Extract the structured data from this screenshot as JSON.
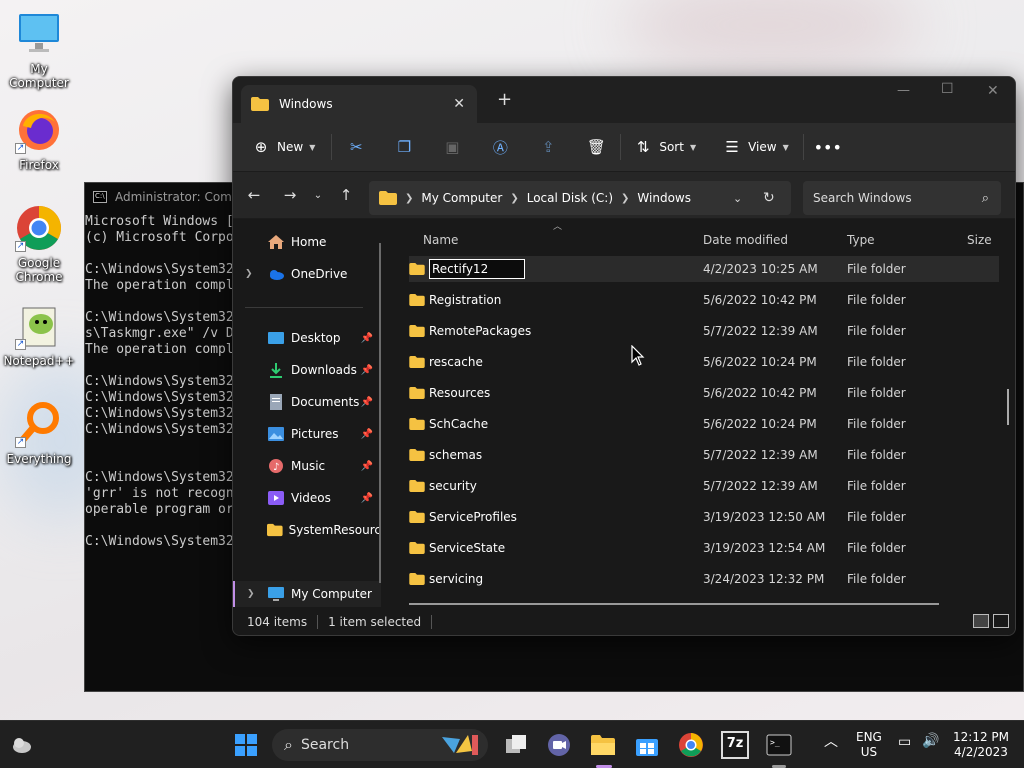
{
  "desktop": {
    "icons": [
      {
        "label": "My Computer"
      },
      {
        "label": "Firefox"
      },
      {
        "label": "Google Chrome"
      },
      {
        "label": "Notepad++"
      },
      {
        "label": "Everything"
      }
    ]
  },
  "cmd": {
    "title": "Administrator: Comm",
    "lines": "Microsoft Windows [\n(c) Microsoft Corpo\n\nC:\\Windows\\System32\nThe operation compl\n\nC:\\Windows\\System32\ns\\Taskmgr.exe\" /v D\nThe operation compl\n\nC:\\Windows\\System32\nC:\\Windows\\System32\nC:\\Windows\\System32\nC:\\Windows\\System32\n\n\nC:\\Windows\\System32\n'grr' is not recogn\noperable program or\n\nC:\\Windows\\System32"
  },
  "explorer": {
    "tab_title": "Windows",
    "toolbar": {
      "new_label": "New",
      "sort_label": "Sort",
      "view_label": "View"
    },
    "breadcrumb": [
      "My Computer",
      "Local Disk (C:)",
      "Windows"
    ],
    "search_placeholder": "Search Windows",
    "nav": {
      "home": "Home",
      "onedrive": "OneDrive",
      "desktop": "Desktop",
      "downloads": "Downloads",
      "documents": "Documents",
      "pictures": "Pictures",
      "music": "Music",
      "videos": "Videos",
      "systemresources": "SystemResourc",
      "mycomputer": "My Computer"
    },
    "columns": {
      "name": "Name",
      "date": "Date modified",
      "type": "Type",
      "size": "Size"
    },
    "rows": [
      {
        "name": "Rectify12",
        "date": "4/2/2023 10:25 AM",
        "type": "File folder"
      },
      {
        "name": "Registration",
        "date": "5/6/2022 10:42 PM",
        "type": "File folder"
      },
      {
        "name": "RemotePackages",
        "date": "5/7/2022 12:39 AM",
        "type": "File folder"
      },
      {
        "name": "rescache",
        "date": "5/6/2022 10:24 PM",
        "type": "File folder"
      },
      {
        "name": "Resources",
        "date": "5/6/2022 10:42 PM",
        "type": "File folder"
      },
      {
        "name": "SchCache",
        "date": "5/6/2022 10:24 PM",
        "type": "File folder"
      },
      {
        "name": "schemas",
        "date": "5/7/2022 12:39 AM",
        "type": "File folder"
      },
      {
        "name": "security",
        "date": "5/7/2022 12:39 AM",
        "type": "File folder"
      },
      {
        "name": "ServiceProfiles",
        "date": "3/19/2023 12:50 AM",
        "type": "File folder"
      },
      {
        "name": "ServiceState",
        "date": "3/19/2023 12:54 AM",
        "type": "File folder"
      },
      {
        "name": "servicing",
        "date": "3/24/2023 12:32 PM",
        "type": "File folder"
      }
    ],
    "status": {
      "count": "104 items",
      "selected": "1 item selected"
    }
  },
  "taskbar": {
    "search_label": "Search",
    "lang_top": "ENG",
    "lang_bottom": "US",
    "time": "12:12 PM",
    "date": "4/2/2023",
    "sevenzip_label": "7z"
  },
  "colors": {
    "accent": "#6fb1ff",
    "folder": "#f5c242",
    "window_bg": "#191919"
  }
}
